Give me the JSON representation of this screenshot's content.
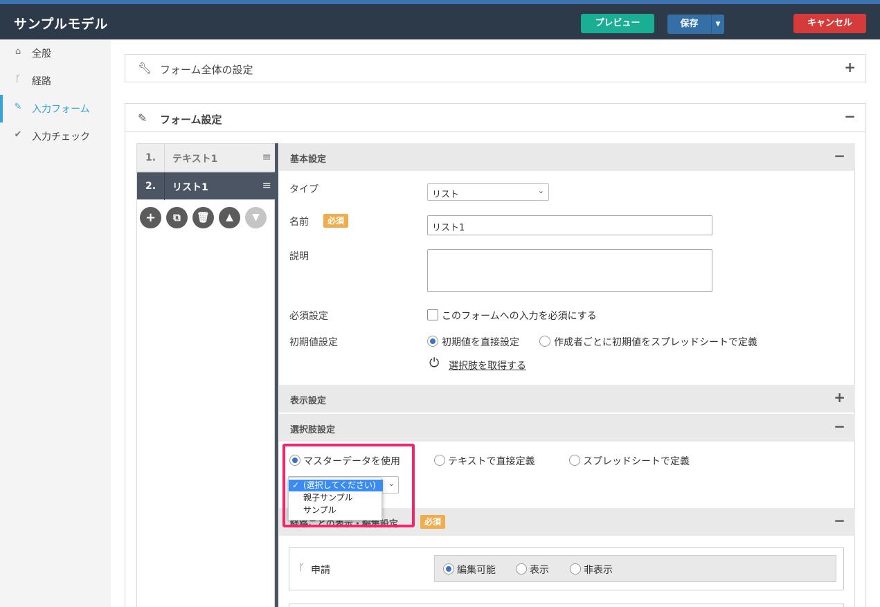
{
  "header": {
    "title": "サンプルモデル",
    "preview_label": "プレビュー",
    "save_label": "保存",
    "cancel_label": "キャンセル"
  },
  "sidebar": {
    "items": [
      {
        "label": "全般",
        "icon": "home-icon"
      },
      {
        "label": "経路",
        "icon": "branch-icon"
      },
      {
        "label": "入力フォーム",
        "icon": "pencil-icon"
      },
      {
        "label": "入力チェック",
        "icon": "check-icon"
      }
    ],
    "active_index": 2
  },
  "panels": {
    "global_title": "フォーム全体の設定",
    "form_title": "フォーム設定"
  },
  "questions": [
    {
      "num": "1.",
      "label": "テキスト1"
    },
    {
      "num": "2.",
      "label": "リスト1"
    }
  ],
  "basic": {
    "section_title": "基本設定",
    "type_label": "タイプ",
    "type_value": "リスト",
    "name_label": "名前",
    "required_badge": "必須",
    "name_value": "リスト1",
    "desc_label": "説明",
    "required_setting_label": "必須設定",
    "required_checkbox_label": "このフォームへの入力を必須にする",
    "initial_label": "初期値設定",
    "initial_opt1": "初期値を直接設定",
    "initial_opt2": "作成者ごとに初期値をスプレッドシートで定義",
    "fetch_link": "選択肢を取得する"
  },
  "display": {
    "section_title": "表示設定"
  },
  "choices": {
    "section_title": "選択肢設定",
    "opt_master": "マスターデータを使用",
    "opt_text": "テキストで直接定義",
    "opt_sheet": "スプレッドシートで定義",
    "dropdown_options": [
      "(選択してください)",
      "親子サンプル",
      "サンプル"
    ]
  },
  "route": {
    "section_title": "経路ごとの表示・編集設定",
    "required_badge": "必須",
    "step_label": "申請",
    "opt_edit": "編集可能",
    "opt_show": "表示",
    "opt_hide": "非表示"
  },
  "colors": {
    "header_bg": "#2c3a4a",
    "preview": "#1aaf94",
    "save": "#3470a6",
    "cancel": "#d63b3b",
    "accent": "#35a4d6",
    "highlight": "#f3266a",
    "badge": "#f0ad4e"
  }
}
